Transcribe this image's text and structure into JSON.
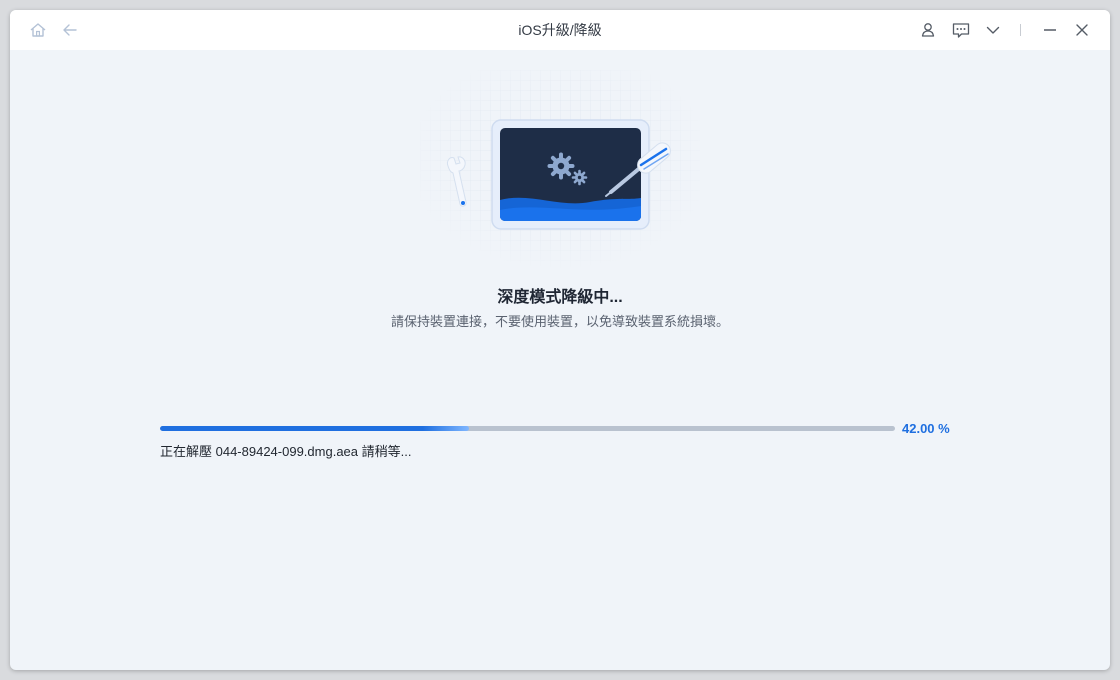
{
  "window": {
    "title": "iOS升級/降級"
  },
  "titlebar": {
    "icons": [
      "home-icon",
      "back-arrow-icon",
      "user-icon",
      "feedback-icon",
      "chevron-down-icon",
      "minimize-icon",
      "close-icon"
    ]
  },
  "main": {
    "title": "深度模式降級中...",
    "subtitle": "請保持裝置連接，不要使用裝置，以免導致裝置系統損壞。"
  },
  "progress": {
    "percent": 42,
    "percent_label": "42.00 %",
    "status": "正在解壓 044-89424-099.dmg.aea 請稍等..."
  },
  "colors": {
    "accent": "#1f6fe0",
    "background": "#f0f4f9",
    "screen": "#1e2d47"
  }
}
